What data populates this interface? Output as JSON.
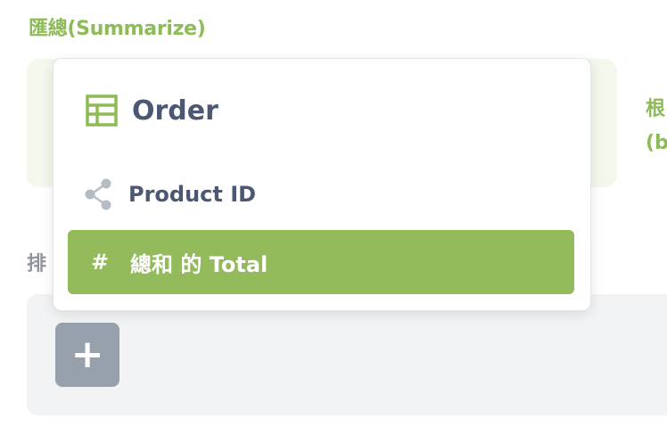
{
  "summarize": {
    "title": "匯總(Summarize)"
  },
  "right_label": {
    "line1": "根",
    "line2": "(b"
  },
  "sort": {
    "label": "排"
  },
  "add_button": {
    "label": "+"
  },
  "popover": {
    "table_icon": "table-grid-icon",
    "table_name": "Order",
    "fields": [
      {
        "icon": "connection-icon",
        "label": "Product ID"
      },
      {
        "icon": "hash-icon",
        "symbol": "#",
        "label": "總和 的 Total",
        "selected": true
      }
    ]
  },
  "colors": {
    "accent_green": "#8dbb55",
    "selected_green": "#93bb5b",
    "dark_text": "#4c5773",
    "muted_gray": "#97a1ab"
  }
}
